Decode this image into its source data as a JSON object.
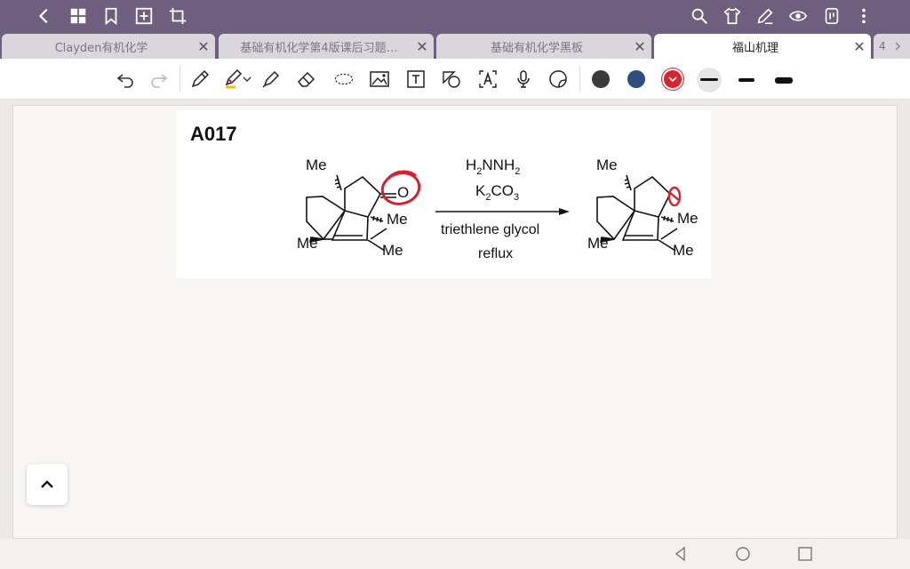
{
  "tabs": [
    {
      "label": "Clayden有机化学",
      "close": "✕"
    },
    {
      "label": "基础有机化学第4版课后习题…",
      "close": "✕"
    },
    {
      "label": "基础有机化学黑板",
      "close": "✕"
    },
    {
      "label": "福山机理",
      "close": "✕"
    }
  ],
  "tab_count": "4",
  "toolbar": {
    "colors": [
      "#3a3a3a",
      "#2f4d7f",
      "#d8242f"
    ]
  },
  "content": {
    "title": "A017",
    "reactant": {
      "me_top": "Me",
      "carbonyl_o": "O",
      "me_right": "Me",
      "me_left": "Me",
      "me_bottom": "Me"
    },
    "reagents": {
      "line1": "H",
      "line1_sub": "2",
      "line1b": "NNH",
      "line1b_sub": "2",
      "line2": "K",
      "line2_sub": "2",
      "line2b": "CO",
      "line2b_sub": "3",
      "solvent": "triethlene glycol",
      "condition": "reflux"
    },
    "product": {
      "me_top": "Me",
      "me_right": "Me",
      "me_left": "Me",
      "me_bottom": "Me"
    }
  },
  "annotations": {
    "ink_color": "#d42030"
  }
}
